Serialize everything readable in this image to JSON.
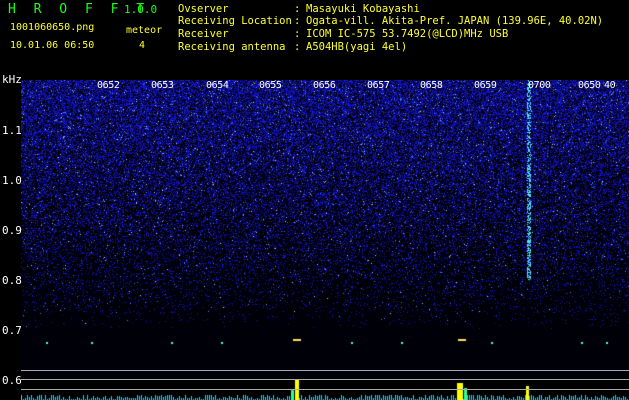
{
  "header": {
    "title": "H R O F F T",
    "version": "1.0.0",
    "filename": "1001060650.png",
    "datetime": "10.01.06 06:50",
    "meteor_label": "meteor",
    "meteor_count": "4"
  },
  "info": [
    {
      "key": "Ovserver",
      "value": "Masayuki Kobayashi"
    },
    {
      "key": "Receiving Location",
      "value": "Ogata-vill. Akita-Pref. JAPAN (139.96E, 40.02N)"
    },
    {
      "key": "Receiver",
      "value": "ICOM IC-575 53.7492(@LCD)MHz USB"
    },
    {
      "key": "Receiving antenna",
      "value": "A504HB(yagi 4el)"
    }
  ],
  "axis": {
    "unit": "kHz",
    "ticks": [
      "1.1",
      "1.0",
      "0.9",
      "0.8",
      "0.7",
      "0.6"
    ]
  },
  "time_labels": [
    "0652",
    "0653",
    "0654",
    "0655",
    "0656",
    "0657",
    "0658",
    "0659",
    "0700",
    "0650",
    "40"
  ],
  "colors": {
    "title_green": "#19ff19",
    "text_yellow": "#ffff33",
    "noise_blue": "#2a2aff",
    "signal_cyan": "#33ffff",
    "peak_yellow": "#ffff00"
  }
}
